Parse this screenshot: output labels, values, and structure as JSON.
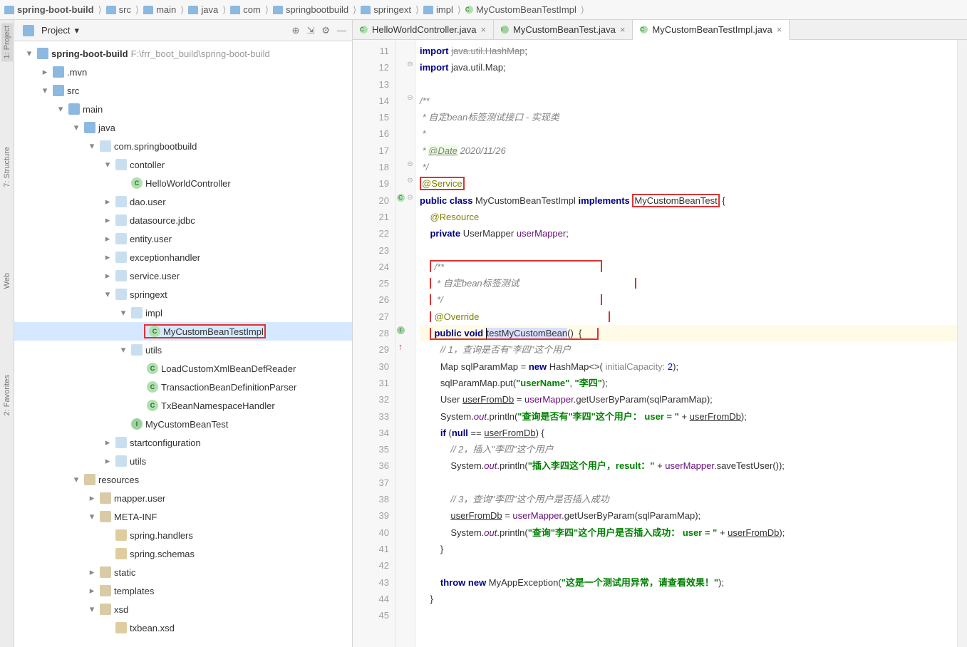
{
  "breadcrumb": [
    "spring-boot-build",
    "src",
    "main",
    "java",
    "com",
    "springbootbuild",
    "springext",
    "impl",
    "MyCustomBeanTestImpl"
  ],
  "panel": {
    "title": "Project",
    "dropdown": "▾",
    "tools": {
      "target": "⊕",
      "collapse": "⇲",
      "gear": "⚙",
      "hide": "—"
    }
  },
  "tree": [
    {
      "d": 0,
      "ex": "▾",
      "ico": "folder",
      "label": "spring-boot-build",
      "suffix": "F:\\frr_boot_build\\spring-boot-build",
      "bold": true
    },
    {
      "d": 1,
      "ex": "▸",
      "ico": "folder",
      "label": ".mvn"
    },
    {
      "d": 1,
      "ex": "▾",
      "ico": "folder",
      "label": "src"
    },
    {
      "d": 2,
      "ex": "▾",
      "ico": "folder",
      "label": "main"
    },
    {
      "d": 3,
      "ex": "▾",
      "ico": "folder",
      "label": "java"
    },
    {
      "d": 4,
      "ex": "▾",
      "ico": "folder-lt",
      "label": "com.springbootbuild"
    },
    {
      "d": 5,
      "ex": "▾",
      "ico": "folder-lt",
      "label": "contoller"
    },
    {
      "d": 6,
      "ex": "",
      "ico": "file-c",
      "glyph": "C",
      "label": "HelloWorldController"
    },
    {
      "d": 5,
      "ex": "▸",
      "ico": "folder-lt",
      "label": "dao.user"
    },
    {
      "d": 5,
      "ex": "▸",
      "ico": "folder-lt",
      "label": "datasource.jdbc"
    },
    {
      "d": 5,
      "ex": "▸",
      "ico": "folder-lt",
      "label": "entity.user"
    },
    {
      "d": 5,
      "ex": "▸",
      "ico": "folder-lt",
      "label": "exceptionhandler"
    },
    {
      "d": 5,
      "ex": "▸",
      "ico": "folder-lt",
      "label": "service.user"
    },
    {
      "d": 5,
      "ex": "▾",
      "ico": "folder-lt",
      "label": "springext"
    },
    {
      "d": 6,
      "ex": "▾",
      "ico": "folder-lt",
      "label": "impl"
    },
    {
      "d": 7,
      "ex": "",
      "ico": "file-c",
      "glyph": "C",
      "label": "MyCustomBeanTestImpl",
      "sel": true,
      "redbox": true
    },
    {
      "d": 6,
      "ex": "▾",
      "ico": "folder-lt",
      "label": "utils"
    },
    {
      "d": 7,
      "ex": "",
      "ico": "file-c",
      "glyph": "C",
      "label": "LoadCustomXmlBeanDefReader"
    },
    {
      "d": 7,
      "ex": "",
      "ico": "file-c",
      "glyph": "C",
      "label": "TransactionBeanDefinitionParser"
    },
    {
      "d": 7,
      "ex": "",
      "ico": "file-c",
      "glyph": "C",
      "label": "TxBeanNamespaceHandler"
    },
    {
      "d": 6,
      "ex": "",
      "ico": "file-i",
      "glyph": "I",
      "label": "MyCustomBeanTest"
    },
    {
      "d": 5,
      "ex": "▸",
      "ico": "folder-lt",
      "label": "startconfiguration"
    },
    {
      "d": 5,
      "ex": "▸",
      "ico": "folder-lt",
      "label": "utils"
    },
    {
      "d": 3,
      "ex": "▾",
      "ico": "folder-or",
      "label": "resources"
    },
    {
      "d": 4,
      "ex": "▸",
      "ico": "folder-or",
      "label": "mapper.user"
    },
    {
      "d": 4,
      "ex": "▾",
      "ico": "folder-or",
      "label": "META-INF"
    },
    {
      "d": 5,
      "ex": "",
      "ico": "file-x",
      "label": "spring.handlers"
    },
    {
      "d": 5,
      "ex": "",
      "ico": "file-x",
      "label": "spring.schemas"
    },
    {
      "d": 4,
      "ex": "▸",
      "ico": "folder-or",
      "label": "static"
    },
    {
      "d": 4,
      "ex": "▸",
      "ico": "folder-or",
      "label": "templates"
    },
    {
      "d": 4,
      "ex": "▾",
      "ico": "folder-or",
      "label": "xsd"
    },
    {
      "d": 5,
      "ex": "",
      "ico": "file-x",
      "label": "txbean.xsd"
    }
  ],
  "tabs": [
    {
      "icon": "C",
      "cls": "bg-c",
      "label": "HelloWorldController.java",
      "active": false
    },
    {
      "icon": "I",
      "cls": "bg-i",
      "label": "MyCustomBeanTest.java",
      "active": false
    },
    {
      "icon": "C",
      "cls": "bg-c",
      "label": "MyCustomBeanTestImpl.java",
      "active": true
    }
  ],
  "close_glyph": "×",
  "lines": {
    "start": 11,
    "end": 45
  },
  "sidebar_labels": {
    "project": "1: Project",
    "structure": "7: Structure",
    "web": "Web",
    "favorites": "2: Favorites"
  },
  "code": {
    "l11": "import java.util.HashMap;",
    "l12": "import java.util.Map;",
    "l14": "/**",
    "l15": " * 自定bean标签测试接口 - 实现类",
    "l16": " *",
    "l17_pre": " * ",
    "l17_tag": "@Date",
    "l17_post": " 2020/11/26",
    "l18": " */",
    "l19_ann": "@Service",
    "l20_pub": "public class ",
    "l20_cls": "MyCustomBeanTestImpl ",
    "l20_imp": "implements ",
    "l20_if": "MyCustomBeanTest",
    "l20_brace": " {",
    "l21_ann": "@Resource",
    "l22_priv": "private ",
    "l22_ty": "UserMapper ",
    "l22_fld": "userMapper",
    "l22_semi": ";",
    "l24": "/**",
    "l25": " * 自定bean标签测试",
    "l26": " */",
    "l27_ann": "@Override",
    "l28_pub": "public void ",
    "l28_m": "testMyCustomBean",
    "l28_p": "()  {",
    "l29": "// 1，查询是否有\"李四\"这个用户",
    "l30a": "Map<String, Object> sqlParamMap = ",
    "l30b": "new ",
    "l30c": "HashMap<>( ",
    "l30d": "initialCapacity:",
    "l30e": " 2",
    "l30f": ");",
    "l31a": "sqlParamMap.put(",
    "l31b": "\"userName\"",
    "l31c": ", ",
    "l31d": "\"李四\"",
    "l31e": ");",
    "l32a": "User ",
    "l32b": "userFromDb",
    "l32c": " = ",
    "l32d": "userMapper",
    "l32e": ".getUserByParam(sqlParamMap);",
    "l33a": "System.",
    "l33b": "out",
    "l33c": ".println(",
    "l33d": "\"查询是否有\"李四\"这个用户： user = \"",
    "l33e": " + ",
    "l33f": "userFromDb",
    "l33g": ");",
    "l34a": "if ",
    "l34b": "(",
    "l34c": "null",
    "l34d": " == ",
    "l34e": "userFromDb",
    "l34f": ") {",
    "l35": "// 2，插入\"李四\"这个用户",
    "l36a": "System.",
    "l36b": "out",
    "l36c": ".println(",
    "l36d": "\"插入李四这个用户，result：\"",
    "l36e": " + ",
    "l36f": "userMapper",
    "l36g": ".saveTestUser());",
    "l38": "// 3，查询\"李四\"这个用户是否插入成功",
    "l39a": "userFromDb",
    "l39b": " = ",
    "l39c": "userMapper",
    "l39d": ".getUserByParam(sqlParamMap);",
    "l40a": "System.",
    "l40b": "out",
    "l40c": ".println(",
    "l40d": "\"查询\"李四\"这个用户是否插入成功： user = \"",
    "l40e": " + ",
    "l40f": "userFromDb",
    "l40g": ");",
    "l41": "}",
    "l43a": "throw new ",
    "l43b": "MyAppException(",
    "l43c": "\"这是一个测试用异常，请查看效果！\"",
    "l43d": ");",
    "l44": "}"
  }
}
